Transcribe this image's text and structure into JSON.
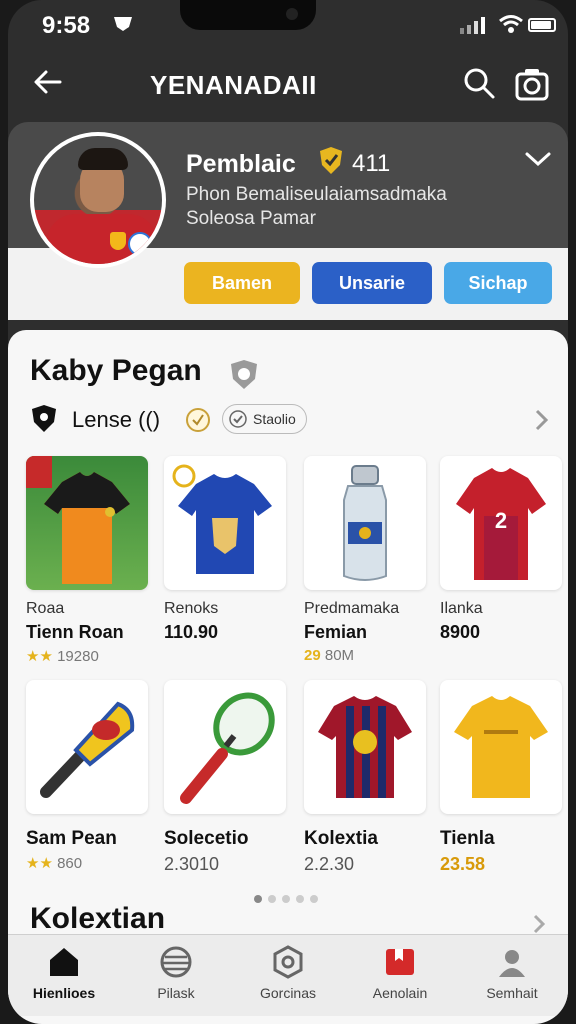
{
  "status": {
    "time": "9:58"
  },
  "header": {
    "title": "YENANADAII"
  },
  "profile": {
    "name": "Pemblaic",
    "count": "411",
    "desc1": "Phon Bemaliseulaiamsadmaka",
    "desc2": "Soleosa Pamar"
  },
  "actions": {
    "btn1": "Bamen",
    "btn2": "Unsarie",
    "btn3": "Sichap"
  },
  "section": {
    "title": "Kaby Pegan",
    "league": "Lense",
    "league_suffix": "(()",
    "pill": "Staolio"
  },
  "products": [
    {
      "brand": "Roaa",
      "name": "Tienn Roan",
      "meta_prefix": "★★",
      "meta": "19280"
    },
    {
      "brand": "Renoks",
      "name": "110.90",
      "meta_prefix": "",
      "meta": ""
    },
    {
      "brand": "Predmamaka",
      "name": "Femian",
      "meta_prefix": "29",
      "meta": "80M"
    },
    {
      "brand": "Ilanka",
      "name": "8900",
      "meta_prefix": "",
      "meta": ""
    },
    {
      "brand": "Sam Pean",
      "meta_prefix": "★★",
      "meta": "860"
    },
    {
      "brand": "Solecetio",
      "meta": "2.3010"
    },
    {
      "brand": "Kolextia",
      "meta": "2.2.30"
    },
    {
      "brand": "Tienla",
      "meta": "23.58"
    }
  ],
  "next_section": {
    "title": "Kolextian"
  },
  "nav": [
    {
      "label": "Hienlioes",
      "icon": "home-icon"
    },
    {
      "label": "Pilask",
      "icon": "ball-icon"
    },
    {
      "label": "Gorcinas",
      "icon": "badge-icon"
    },
    {
      "label": "Aenolain",
      "icon": "store-icon"
    },
    {
      "label": "Semhait",
      "icon": "profile-icon"
    }
  ],
  "colors": {
    "accent_yellow": "#ebb420",
    "accent_blue": "#2b60c7",
    "accent_lightblue": "#49a8e7",
    "header_bg": "#2e2e2e"
  }
}
